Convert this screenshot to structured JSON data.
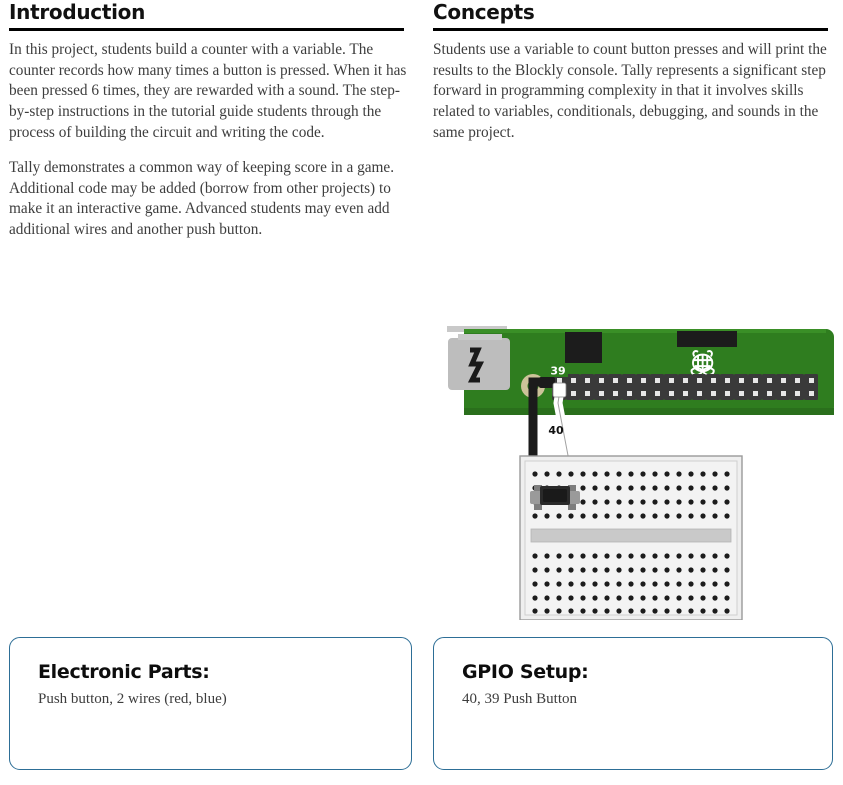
{
  "sections": [
    {
      "title": "Introduction",
      "paragraphs": [
        "In this project, students build a counter with a variable. The counter records how many times a button is pressed. When it has been pressed 6 times, they are rewarded with a sound. The step-by-step instructions in the tutorial guide students through the process of building the circuit and writing the code.",
        "Tally demonstrates a common way of keeping score in a game. Additional code may be added (borrow from other projects) to make it an interactive game. Advanced students may even add additional wires and another push button."
      ]
    },
    {
      "title": "Concepts",
      "paragraphs": [
        "Students use a variable to count button presses and will print the results to the Blockly console.  Tally represents a significant step forward in programming complexity in that it involves skills related to variables, conditionals, debugging, and sounds in the same project."
      ]
    }
  ],
  "figure": {
    "name": "raspberry-pi-breadboard-wiring-diagram",
    "board_label": "Raspberry Pi Zero board",
    "logo": "raspberry-pi-logo",
    "usb_port": "usb-port",
    "wire_labels": [
      "39",
      "40"
    ],
    "wires": [
      {
        "pin": "39",
        "color": "#1b1b1b",
        "name": "wire-pin-39"
      },
      {
        "pin": "40",
        "color": "#ffffff",
        "name": "wire-pin-40"
      }
    ],
    "breadboard": {
      "columns": 17,
      "top_rows": 4,
      "bottom_rows": 5,
      "component": "push-button"
    },
    "colors": {
      "pcb_green": "#2f7d1f",
      "pcb_green_dark": "#1f5f15",
      "header_dark": "#3a3a3a",
      "breadboard": "#efefef",
      "pad_tan": "#cdc39a"
    }
  },
  "cards": [
    {
      "title": "Electronic Parts:",
      "text": "Push button, 2 wires (red, blue)"
    },
    {
      "title": "GPIO Setup:",
      "text": "40, 39 Push Button"
    }
  ],
  "theme": {
    "accent": "#2d6e96",
    "rule": "#000000",
    "text": "#3d3d3d"
  }
}
